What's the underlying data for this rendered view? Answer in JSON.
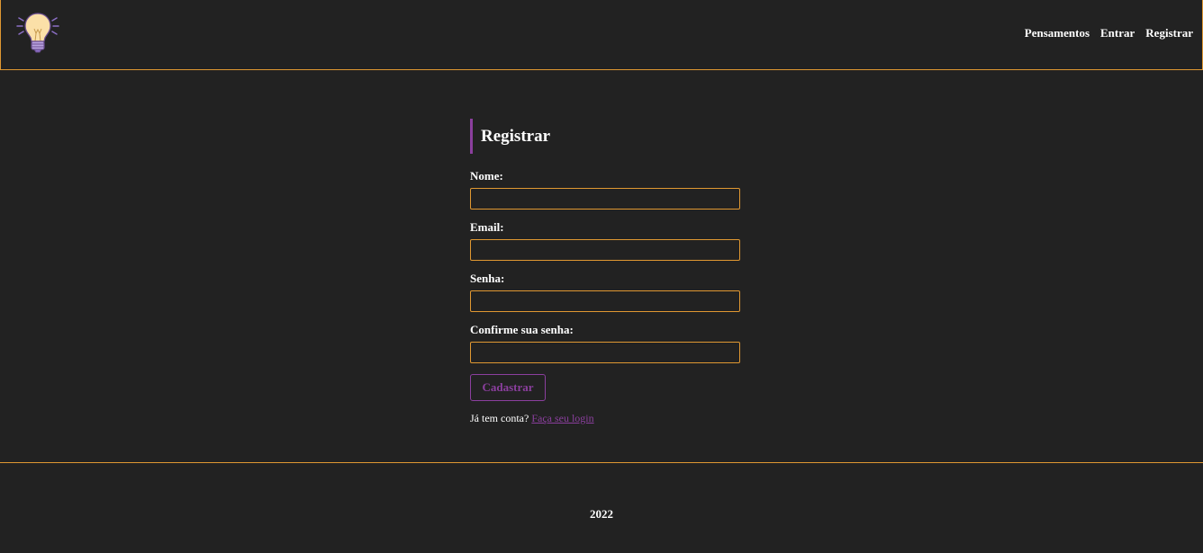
{
  "navbar": {
    "logo_icon": "lightbulb-icon",
    "links": [
      {
        "label": "Pensamentos"
      },
      {
        "label": "Entrar"
      },
      {
        "label": "Registrar"
      }
    ]
  },
  "form": {
    "title": "Registrar",
    "fields": [
      {
        "label": "Nome:",
        "value": ""
      },
      {
        "label": "Email:",
        "value": ""
      },
      {
        "label": "Senha:",
        "value": ""
      },
      {
        "label": "Confirme sua senha:",
        "value": ""
      }
    ],
    "submit_label": "Cadastrar",
    "login_prompt": "Já tem conta?",
    "login_link": "Faça seu login"
  },
  "footer": {
    "year": "2022"
  },
  "colors": {
    "background": "#222222",
    "accent_orange": "#e09832",
    "accent_purple": "#8b3f9e",
    "text": "#ffffff"
  }
}
